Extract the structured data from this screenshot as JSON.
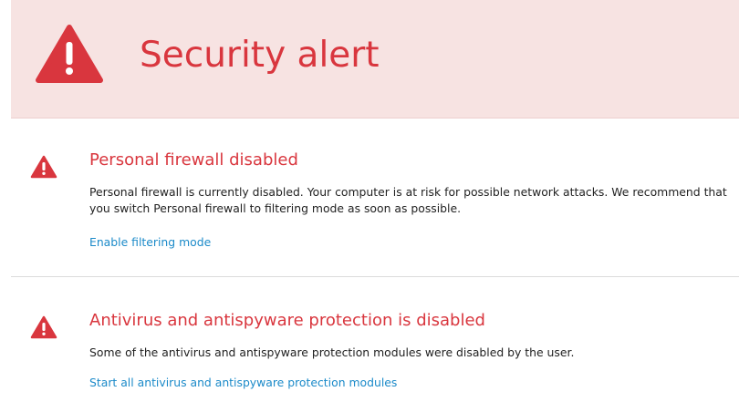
{
  "header": {
    "title": "Security alert",
    "icon": "warning-triangle-icon",
    "background_color": "#f7e3e2",
    "accent_color": "#d9363e"
  },
  "alerts": [
    {
      "icon": "warning-triangle-icon",
      "title": "Personal firewall disabled",
      "text": "Personal firewall is currently disabled. Your computer is at risk for possible network attacks. We recommend that you switch Personal firewall to filtering mode as soon as possible.",
      "link": "Enable filtering mode"
    },
    {
      "icon": "warning-triangle-icon",
      "title": "Antivirus and antispyware protection is disabled",
      "text": "Some of the antivirus and antispyware protection modules were disabled by the user.",
      "link": "Start all antivirus and antispyware protection modules"
    }
  ],
  "colors": {
    "link": "#1b8ac9",
    "body_text": "#222222"
  }
}
